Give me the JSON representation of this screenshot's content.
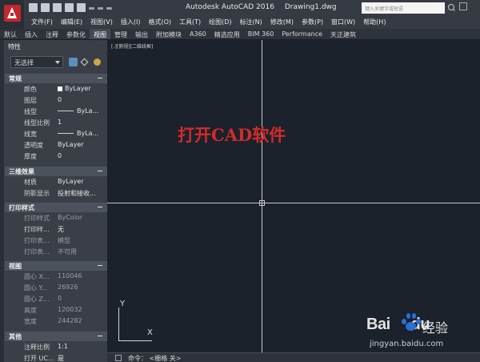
{
  "titlebar": {
    "app_name": "Autodesk AutoCAD 2016",
    "document": "Drawing1.dwg",
    "search_placeholder": "键入关键字或短语"
  },
  "menu": [
    "文件(F)",
    "编辑(E)",
    "视图(V)",
    "插入(I)",
    "格式(O)",
    "工具(T)",
    "绘图(D)",
    "标注(N)",
    "修改(M)",
    "参数(P)",
    "窗口(W)",
    "帮助(H)"
  ],
  "ribbon_tabs": [
    "默认",
    "插入",
    "注释",
    "参数化",
    "视图",
    "管理",
    "输出",
    "附加模块",
    "A360",
    "精选应用",
    "BIM 360",
    "Performance",
    "天正建筑"
  ],
  "palette": {
    "title": "特性",
    "selection": "无选择",
    "sections": {
      "general": {
        "title": "常规",
        "rows": [
          {
            "key": "颜色",
            "value": "ByLayer"
          },
          {
            "key": "图层",
            "value": "0"
          },
          {
            "key": "线型",
            "value": "ByLa..."
          },
          {
            "key": "线型比例",
            "value": "1"
          },
          {
            "key": "线宽",
            "value": "ByLa..."
          },
          {
            "key": "透明度",
            "value": "ByLayer"
          },
          {
            "key": "厚度",
            "value": "0"
          }
        ]
      },
      "3d": {
        "title": "三维效果",
        "rows": [
          {
            "key": "材质",
            "value": "ByLayer"
          },
          {
            "key": "阴影显示",
            "value": "投射和接收..."
          }
        ]
      },
      "plot": {
        "title": "打印样式",
        "rows": [
          {
            "key": "打印样式",
            "value": "ByColor"
          },
          {
            "key": "打印样...",
            "value": "无"
          },
          {
            "key": "打印表...",
            "value": "模型"
          },
          {
            "key": "打印表...",
            "value": "不可用"
          }
        ]
      },
      "view": {
        "title": "视图",
        "rows": [
          {
            "key": "圆心 X...",
            "value": "110046"
          },
          {
            "key": "圆心 Y...",
            "value": "26926"
          },
          {
            "key": "圆心 Z...",
            "value": "0"
          },
          {
            "key": "高度",
            "value": "120032"
          },
          {
            "key": "宽度",
            "value": "244282"
          }
        ]
      },
      "misc": {
        "title": "其他",
        "rows": [
          {
            "key": "注释比例",
            "value": "1:1"
          },
          {
            "key": "打开 UC...",
            "value": "是"
          }
        ]
      }
    }
  },
  "canvas": {
    "viewport_label": "[-][俯视][二维线框]",
    "overlay_text": "打开CAD软件",
    "ucs_x": "X",
    "ucs_y": "Y"
  },
  "command_line": {
    "text": "命令： <栅格 关>"
  },
  "watermark": {
    "brand_bai": "Bai",
    "brand_du": "du",
    "brand_jingyan": "经验",
    "url": "jingyan.baidu.com"
  },
  "colors": {
    "canvas_bg": "#1b222b",
    "palette_bg": "#3a3f47",
    "overlay_text": "#d42a2a",
    "logo_red": "#c1272d"
  }
}
